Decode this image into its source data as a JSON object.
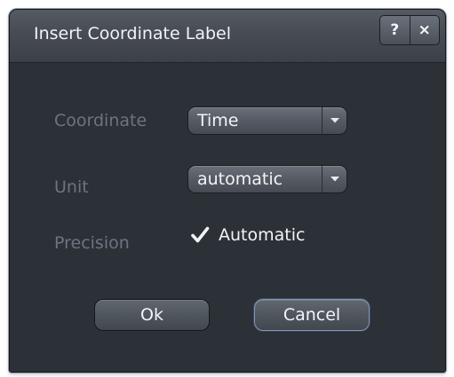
{
  "dialog": {
    "title": "Insert Coordinate Label",
    "help_label": "?",
    "close_label": "×"
  },
  "form": {
    "coordinate": {
      "label": "Coordinate",
      "value": "Time"
    },
    "unit": {
      "label": "Unit",
      "value": "automatic"
    },
    "precision": {
      "label": "Precision",
      "checkbox_label": "Automatic",
      "checked": true
    }
  },
  "buttons": {
    "ok_label": "Ok",
    "cancel_label": "Cancel"
  },
  "colors": {
    "window_bg": "#2c3037",
    "titlebar": "#474c54",
    "label_text": "#6d7480",
    "value_text": "#f3f4f6",
    "focus_border": "#7f95b1"
  },
  "icons": {
    "help": "question-icon",
    "close": "close-icon",
    "dropdown": "chevron-down-icon",
    "check": "checkmark-icon"
  }
}
